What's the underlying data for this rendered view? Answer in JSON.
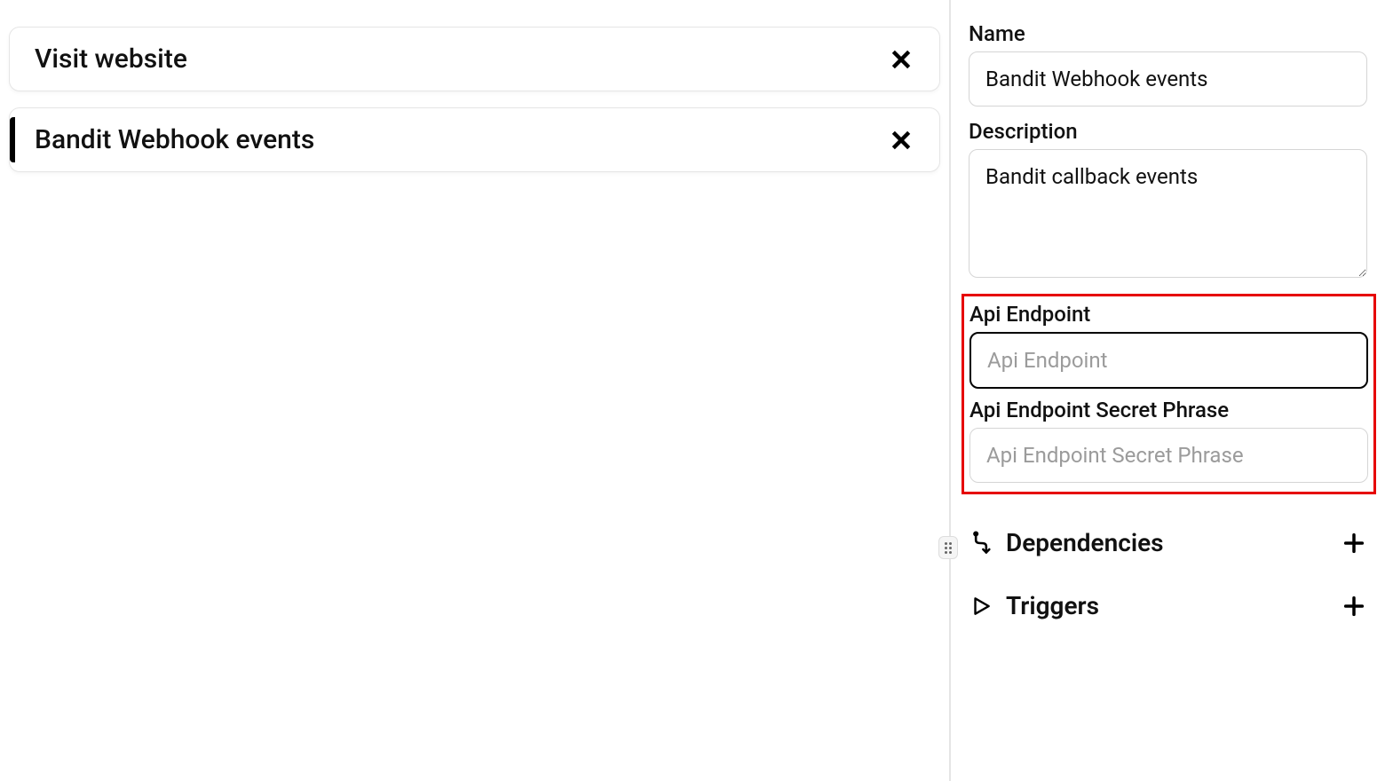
{
  "left": {
    "items": [
      {
        "title": "Visit website",
        "selected": false
      },
      {
        "title": "Bandit Webhook events",
        "selected": true
      }
    ]
  },
  "right": {
    "name_label": "Name",
    "name_value": "Bandit Webhook events",
    "description_label": "Description",
    "description_value": "Bandit callback events",
    "api_endpoint_label": "Api Endpoint",
    "api_endpoint_placeholder": "Api Endpoint",
    "api_endpoint_value": "",
    "api_secret_label": "Api Endpoint Secret Phrase",
    "api_secret_placeholder": "Api Endpoint Secret Phrase",
    "api_secret_value": "",
    "dependencies_label": "Dependencies",
    "triggers_label": "Triggers"
  }
}
